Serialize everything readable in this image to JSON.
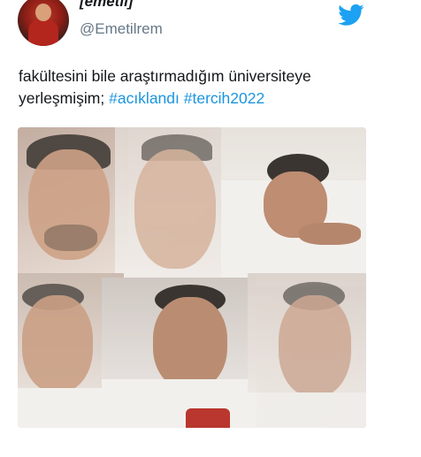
{
  "author": {
    "display_name": "[emetil]",
    "handle": "@Emetilrem"
  },
  "icons": {
    "avatar": "profile-photo",
    "brand": "twitter-bird-icon"
  },
  "colors": {
    "hashtag": "#1b95e0",
    "twitter_blue": "#1da1f2",
    "handle_gray": "#657786",
    "text": "#14171a"
  },
  "tweet": {
    "text_part1": "fakültesini bile araştırmadığım üniversiteye yerleşmişim;",
    "hashtags": [
      "#acıklandı",
      "#tercih2022"
    ]
  },
  "media": {
    "type": "photo-collage",
    "panels": 6
  }
}
